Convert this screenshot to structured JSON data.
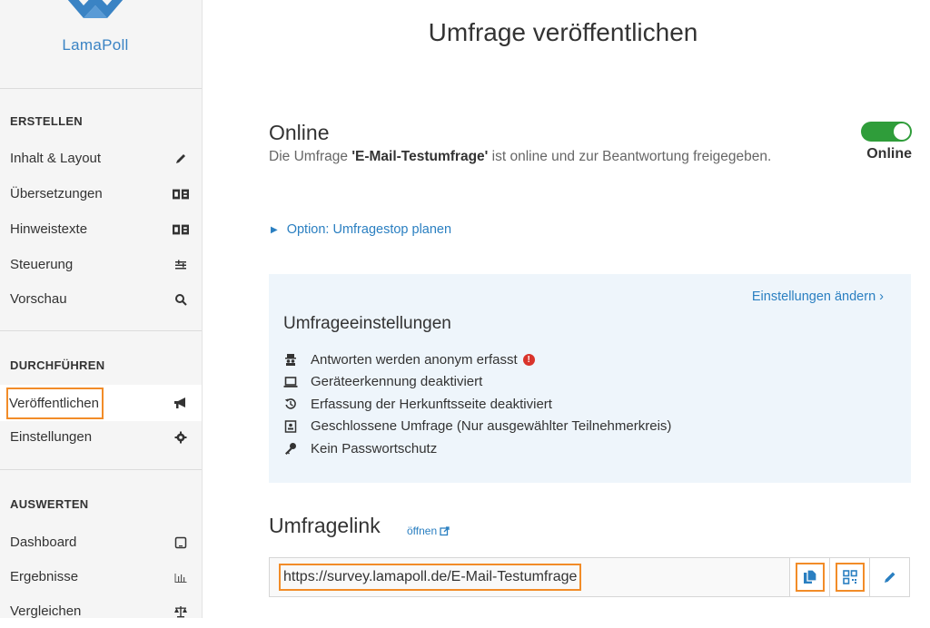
{
  "brand": {
    "name": "LamaPoll"
  },
  "sidebar": {
    "sections": [
      {
        "title": "ERSTELLEN",
        "items": [
          {
            "label": "Inhalt & Layout",
            "icon": "pencil-icon"
          },
          {
            "label": "Übersetzungen",
            "icon": "translate-icon"
          },
          {
            "label": "Hinweistexte",
            "icon": "translate-icon"
          },
          {
            "label": "Steuerung",
            "icon": "sliders-icon"
          },
          {
            "label": "Vorschau",
            "icon": "search-icon"
          }
        ]
      },
      {
        "title": "DURCHFÜHREN",
        "items": [
          {
            "label": "Veröffentlichen",
            "icon": "megaphone-icon",
            "active": true
          },
          {
            "label": "Einstellungen",
            "icon": "gear-icon"
          }
        ]
      },
      {
        "title": "AUSWERTEN",
        "items": [
          {
            "label": "Dashboard",
            "icon": "tablet-icon"
          },
          {
            "label": "Ergebnisse",
            "icon": "bar-chart-icon"
          },
          {
            "label": "Vergleichen",
            "icon": "scales-icon"
          }
        ]
      }
    ]
  },
  "main": {
    "title": "Umfrage veröffentlichen",
    "online": {
      "heading": "Online",
      "desc_prefix": "Die Umfrage ",
      "survey_name": "'E-Mail-Testumfrage'",
      "desc_suffix": " ist online und zur Beantwortung freigegeben.",
      "toggle_label": "Online",
      "toggle_on": true
    },
    "option_link": "Option: Umfragestop planen",
    "settings": {
      "change_link": "Einstellungen ändern ›",
      "title": "Umfrageeinstellungen",
      "items": [
        {
          "text": "Antworten werden anonym erfasst",
          "icon": "spy-icon",
          "warning": true
        },
        {
          "text": "Geräteerkennung deaktiviert",
          "icon": "laptop-icon"
        },
        {
          "text": "Erfassung der Herkunftsseite deaktiviert",
          "icon": "history-icon"
        },
        {
          "text": "Geschlossene Umfrage (Nur ausgewählter Teilnehmerkreis)",
          "icon": "contact-card-icon"
        },
        {
          "text": "Kein Passwortschutz",
          "icon": "key-icon"
        }
      ]
    },
    "link": {
      "title": "Umfragelink",
      "open_label": "öffnen",
      "url": "https://survey.lamapoll.de/E-Mail-Testumfrage"
    }
  },
  "colors": {
    "accent": "#2a7fc1",
    "highlight": "#f28c28",
    "toggle": "#2f9d3a",
    "panel": "#eef5fb"
  }
}
